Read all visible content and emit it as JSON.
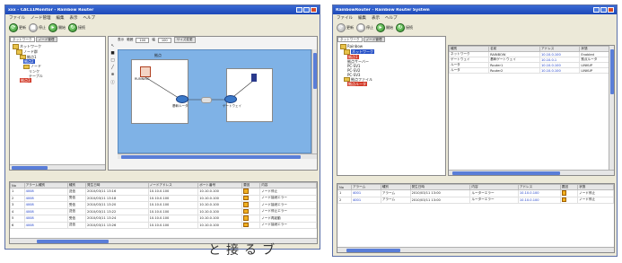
{
  "left_window": {
    "title": "xxx - CAC11Monitor - Rainbow Router",
    "menu": [
      "ファイル",
      "ノード管理",
      "編集",
      "表示",
      "ヘルプ"
    ],
    "toolbar": [
      {
        "label": "更新",
        "icon": "refresh-icon",
        "enabled": true
      },
      {
        "label": "停止",
        "icon": "stop-icon",
        "enabled": false
      },
      {
        "label": "開始",
        "icon": "play-icon",
        "enabled": true
      },
      {
        "label": "接続",
        "icon": "connect-icon",
        "enabled": true
      }
    ],
    "tabs": [
      "ネットワーク",
      "ノード管理"
    ],
    "tree": [
      {
        "label": "ネットワーク",
        "level": 0,
        "state": "normal"
      },
      {
        "label": "ノード群",
        "level": 1,
        "state": "normal"
      },
      {
        "label": "拠点1",
        "level": 2,
        "state": "normal"
      },
      {
        "label": "拠点2",
        "level": 3,
        "state": "selected"
      },
      {
        "label": "ノード",
        "level": 3,
        "state": "normal"
      },
      {
        "label": "リンク",
        "level": 4,
        "state": "normal"
      },
      {
        "label": "テーブル",
        "level": 4,
        "state": "normal"
      },
      {
        "label": "拠点3",
        "level": 2,
        "state": "error"
      }
    ],
    "map_toolbar": [
      "表示",
      "範囲",
      "100",
      "幅",
      "100",
      "サイズ変更"
    ],
    "map_title": "拠点",
    "map_devices": [
      "RUNNING",
      "基幹ルータ",
      "ゲートウェイ",
      "PC"
    ],
    "table_headers": [
      "No",
      "アラーム種別",
      "種別",
      "発生日時",
      "ノードアドレス",
      "ポート番号",
      "要因",
      "内容"
    ],
    "table_rows": [
      [
        "1",
        "4008",
        "送信",
        "2010/03/11 13:16",
        "10.10.0.100",
        "10.10.0.100",
        "!",
        "ノード停止"
      ],
      [
        "2",
        "4008",
        "受信",
        "2010/03/11 13:18",
        "10.10.0.100",
        "10.10.0.100",
        "!",
        "ノード接続エラー"
      ],
      [
        "3",
        "4008",
        "受信",
        "2010/03/11 13:20",
        "10.10.0.100",
        "10.10.0.100",
        "!",
        "ノード接続エラー"
      ],
      [
        "4",
        "4008",
        "送信",
        "2010/03/11 13:22",
        "10.10.0.100",
        "10.10.0.100",
        "!",
        "ノード停止エラー"
      ],
      [
        "5",
        "4008",
        "受信",
        "2010/03/11 13:24",
        "10.10.0.100",
        "10.10.0.100",
        "!",
        "ノード再起動"
      ],
      [
        "6",
        "4008",
        "送信",
        "2010/03/11 13:26",
        "10.10.0.100",
        "10.10.0.100",
        "!",
        "ノード接続エラー"
      ]
    ]
  },
  "right_window": {
    "title": "RainbowRouter - Rainbow Router System",
    "menu": [
      "ファイル",
      "編集",
      "表示",
      "ヘルプ"
    ],
    "toolbar": [
      {
        "label": "更新",
        "icon": "refresh-icon",
        "enabled": false
      },
      {
        "label": "停止",
        "icon": "stop-icon",
        "enabled": false
      },
      {
        "label": "開始",
        "icon": "play-icon",
        "enabled": true
      },
      {
        "label": "接続",
        "icon": "connect-icon",
        "enabled": true
      }
    ],
    "tabs": [
      "ネットワーク",
      "ノード管理"
    ],
    "tree": [
      {
        "label": "Rainbow",
        "level": 0,
        "state": "normal"
      },
      {
        "label": "ネットワーク",
        "level": 1,
        "state": "selected"
      },
      {
        "label": "拠点1",
        "level": 2,
        "state": "error"
      },
      {
        "label": "拠点サーバー",
        "level": 2,
        "state": "normal"
      },
      {
        "label": "PC-SV1",
        "level": 2,
        "state": "normal"
      },
      {
        "label": "PC-SV2",
        "level": 2,
        "state": "normal"
      },
      {
        "label": "PC-SV3",
        "level": 2,
        "state": "normal"
      },
      {
        "label": "拠点ファイル",
        "level": 1,
        "state": "normal"
      },
      {
        "label": "拠点ルータ",
        "level": 2,
        "state": "error"
      }
    ],
    "detail_headers": [
      "種別",
      "名前",
      "アドレス",
      "状態"
    ],
    "detail_rows": [
      [
        "ネットワーク",
        "RAINBOW",
        "10.10.0.100",
        "Enabled"
      ],
      [
        "ゲートウェイ",
        "基幹ゲートウェイ",
        "10.10.0.1",
        "拠点ルータ"
      ],
      [
        "ルータ",
        "Router1",
        "10.10.0.100",
        "LINKUP"
      ],
      [
        "ルータ",
        "Router2",
        "10.10.0.100",
        "LINKUP"
      ]
    ],
    "alarm_headers": [
      "No",
      "アラーム",
      "種別",
      "発生日時",
      "内容",
      "アドレス",
      "要因",
      "状態"
    ],
    "alarm_rows": [
      [
        "1",
        "4001",
        "アラーム",
        "2010/03/11 13:00",
        "ルーターエラー",
        "10.10.0.100",
        "!",
        "ノード停止"
      ],
      [
        "2",
        "4001",
        "アラーム",
        "2010/03/11 13:00",
        "ルーターエラー",
        "10.10.0.100",
        "!",
        "ノード停止"
      ]
    ]
  },
  "caption": "と接るブ"
}
